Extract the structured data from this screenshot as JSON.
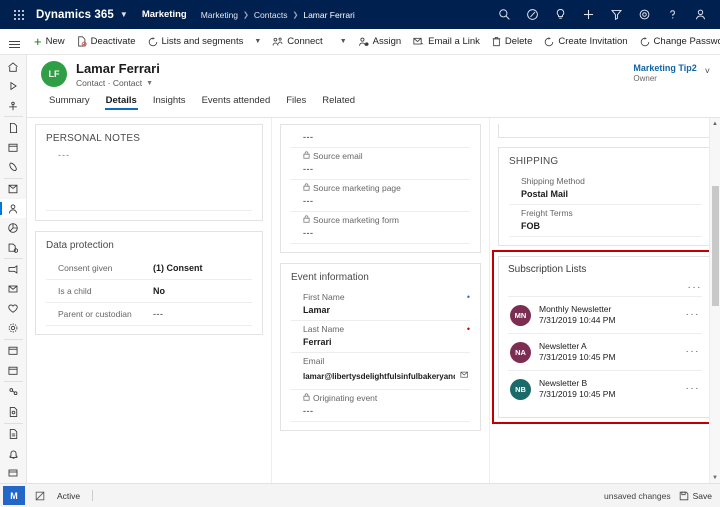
{
  "topnav": {
    "brand": "Dynamics 365",
    "app_name": "Marketing",
    "breadcrumbs": [
      "Marketing",
      "Contacts",
      "Lamar Ferrari"
    ],
    "icons": [
      "search-icon",
      "assistant-icon",
      "lightbulb-icon",
      "plus-icon",
      "filter-icon",
      "gear-icon",
      "help-icon",
      "account-icon"
    ],
    "bg_color": "#002050"
  },
  "commandbar": {
    "items": [
      {
        "label": "New",
        "icon": "plus-icon"
      },
      {
        "label": "Deactivate",
        "icon": "deactivate-icon"
      },
      {
        "label": "Lists and segments",
        "icon": "clock-icon",
        "has_chevron": true
      },
      {
        "label": "Connect",
        "icon": "connect-icon",
        "has_chevron": true,
        "divider_before_chevron": true
      },
      {
        "label": "Assign",
        "icon": "assign-icon"
      },
      {
        "label": "Email a Link",
        "icon": "email-link-icon"
      },
      {
        "label": "Delete",
        "icon": "trash-icon"
      },
      {
        "label": "Create Invitation",
        "icon": "clock-icon"
      },
      {
        "label": "Change Password",
        "icon": "clock-icon"
      }
    ],
    "overflow": "···"
  },
  "rail": {
    "items": [
      "home-icon",
      "recent-icon",
      "pinned-icon",
      "file-icon",
      "calendar-icon",
      "phone-icon",
      "account-box-icon",
      "contact-icon",
      "segment-icon",
      "leads-icon",
      "campaign-icon",
      "mail-icon",
      "heart-icon",
      "settings-gear-icon",
      "calendar2-icon",
      "calendar3-icon",
      "social-icon",
      "survey-icon",
      "form-icon",
      "bell-icon",
      "card-icon"
    ],
    "active_index": 7
  },
  "header": {
    "avatar_initials": "LF",
    "avatar_color": "#2f9e44",
    "title": "Lamar Ferrari",
    "subtitle": "Contact · Contact",
    "owner_name": "Marketing Tip2",
    "owner_role": "Owner",
    "tabs": [
      {
        "label": "Summary",
        "active": false
      },
      {
        "label": "Details",
        "active": true
      },
      {
        "label": "Insights",
        "active": false
      },
      {
        "label": "Events attended",
        "active": false
      },
      {
        "label": "Files",
        "active": false
      },
      {
        "label": "Related",
        "active": false
      }
    ]
  },
  "column1": {
    "personal_notes": {
      "title": "PERSONAL NOTES",
      "value": "---"
    },
    "data_protection": {
      "title": "Data protection",
      "rows": [
        {
          "label": "Consent given",
          "value": "(1) Consent",
          "dim": false
        },
        {
          "label": "Is a child",
          "value": "No",
          "dim": false
        },
        {
          "label": "Parent or custodian",
          "value": "---",
          "dim": true
        }
      ]
    }
  },
  "column2": {
    "top_fields": [
      {
        "label": "",
        "value": "---",
        "locked": false,
        "label_hidden": true
      },
      {
        "label": "Source email",
        "value": "---",
        "locked": true
      },
      {
        "label": "Source marketing page",
        "value": "---",
        "locked": true
      },
      {
        "label": "Source marketing form",
        "value": "---",
        "locked": true
      }
    ],
    "event_information": {
      "title": "Event information",
      "fields": [
        {
          "label": "First Name",
          "value": "Lamar",
          "locked": false,
          "required": "blue"
        },
        {
          "label": "Last Name",
          "value": "Ferrari",
          "locked": false,
          "required": "red"
        },
        {
          "label": "Email",
          "value": "lamar@libertysdelightfulsinfulbakeryandcaf...",
          "locked": false,
          "trailing_icon": "envelope-icon"
        },
        {
          "label": "Originating event",
          "value": "---",
          "locked": true
        }
      ]
    }
  },
  "column3": {
    "shipping": {
      "title": "SHIPPING",
      "fields": [
        {
          "label": "Shipping Method",
          "value": "Postal Mail"
        },
        {
          "label": "Freight Terms",
          "value": "FOB"
        }
      ]
    },
    "subscription_lists": {
      "title": "Subscription Lists",
      "toolbar_overflow": "···",
      "items": [
        {
          "initials": "MN",
          "color": "#7b2d52",
          "name": "Monthly Newsletter",
          "date": "7/31/2019 10:44 PM",
          "overflow": "···"
        },
        {
          "initials": "NA",
          "color": "#7b2d52",
          "name": "Newsletter A",
          "date": "7/31/2019 10:45 PM",
          "overflow": "···"
        },
        {
          "initials": "NB",
          "color": "#1a6a6a",
          "name": "Newsletter B",
          "date": "7/31/2019 10:45 PM",
          "overflow": "···"
        }
      ]
    }
  },
  "statusbar": {
    "logo": "M",
    "state": "Active",
    "unsaved": "unsaved changes",
    "save_label": "Save"
  },
  "highlights": {
    "accent_color": "#c00000"
  }
}
